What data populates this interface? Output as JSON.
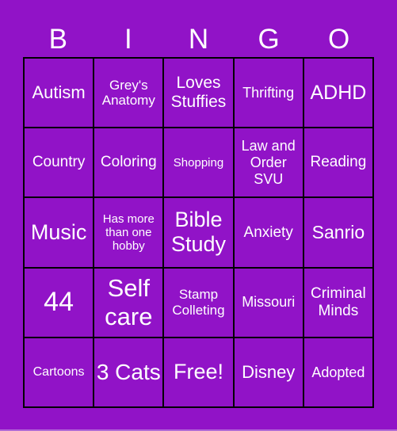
{
  "card": {
    "header": [
      "B",
      "I",
      "N",
      "G",
      "O"
    ],
    "colors": {
      "background": "#9113c7",
      "grid_line": "#000000",
      "text": "#ffffff"
    },
    "cells": [
      [
        "Autism",
        "Grey's Anatomy",
        "Loves Stuffies",
        "Thrifting",
        "ADHD"
      ],
      [
        "Country",
        "Coloring",
        "Shopping",
        "Law and Order SVU",
        "Reading"
      ],
      [
        "Music",
        "Has more than one hobby",
        "Bible Study",
        "Anxiety",
        "Sanrio"
      ],
      [
        "44",
        "Self care",
        "Stamp Colleting",
        "Missouri",
        "Criminal Minds"
      ],
      [
        "Cartoons",
        "3 Cats",
        "Free!",
        "Disney",
        "Adopted"
      ]
    ]
  }
}
